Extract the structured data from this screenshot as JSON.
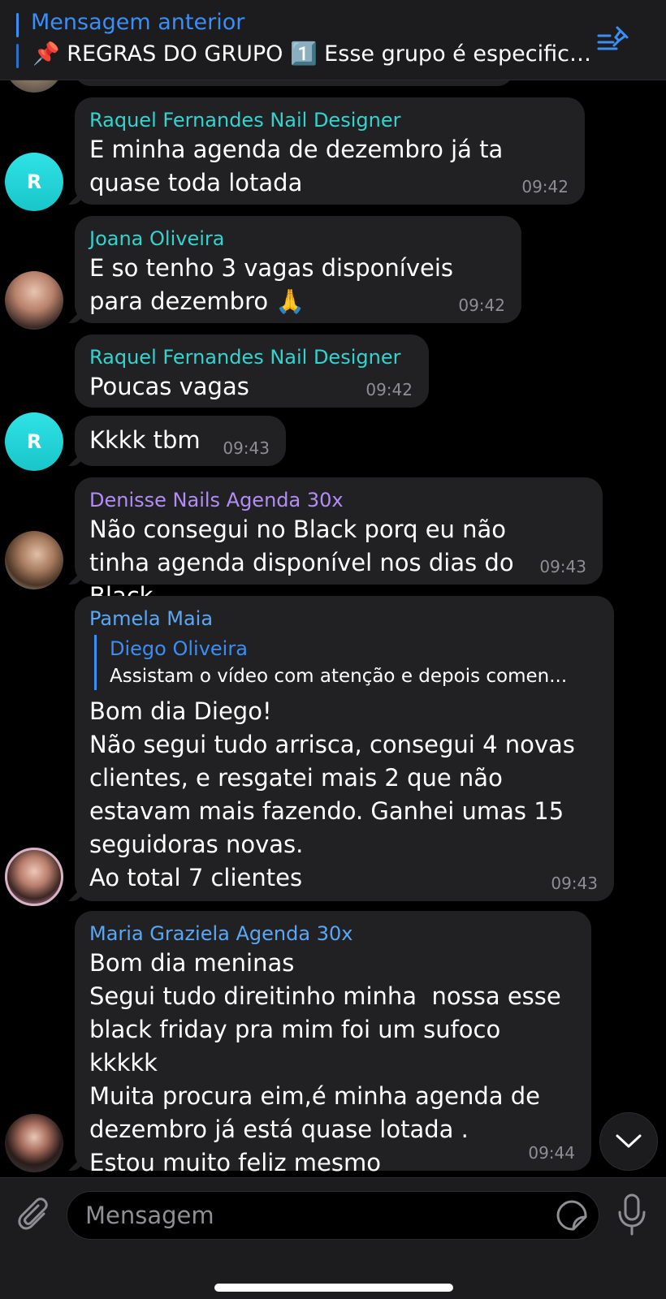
{
  "pinned": {
    "title": "Mensagem anterior",
    "text": "📌 REGRAS DO GRUPO 1️⃣ Esse grupo é especifica..."
  },
  "messages": [
    {
      "sender": "Raquel Fernandes Nail Designer",
      "sender_color": "#34d3cf",
      "text": "E minha agenda de dezembro já ta quase toda lotada",
      "time": "09:42"
    },
    {
      "sender": "Joana Oliveira",
      "sender_color": "#34d3cf",
      "text": "E so tenho 3 vagas disponíveis para dezembro 🙏",
      "time": "09:42"
    },
    {
      "sender": "Raquel Fernandes Nail Designer",
      "sender_color": "#34d3cf",
      "text": "Poucas vagas",
      "time": "09:42"
    },
    {
      "text": "Kkkk tbm",
      "time": "09:43",
      "avatar_letter": "R"
    },
    {
      "sender": "Denisse Nails Agenda 30x",
      "sender_color": "#b38df5",
      "text": "Não consegui no Black porq eu não tinha agenda disponível nos dias do Black",
      "time": "09:43"
    },
    {
      "sender": "Pamela Maia",
      "sender_color": "#5aa7f5",
      "reply_name": "Diego Oliveira",
      "reply_text": "Assistam o vídeo com atenção e depois comen...",
      "text": "Bom dia Diego!\nNão segui tudo arrisca, consegui 4 novas clientes, e resgatei mais 2 que não estavam mais fazendo. Ganhei umas 15 seguidoras novas.\nAo total 7 clientes",
      "time": "09:43"
    },
    {
      "sender": "Maria Graziela Agenda 30x",
      "sender_color": "#5aa7f5",
      "text": "Bom dia meninas\nSegui tudo direitinho minha  nossa esse black friday pra mim foi um sufoco kkkkk\nMuita procura eim,é minha agenda de dezembro já está quase lotada .\nEstou muito feliz mesmo",
      "time": "09:44"
    }
  ],
  "avatar_letter": "R",
  "composer": {
    "placeholder": "Mensagem"
  },
  "icons": {
    "pinned_list": "pinned-list-icon",
    "scroll_down": "chevron-down-icon",
    "attach": "paperclip-icon",
    "sticker": "sticker-icon",
    "mic": "microphone-icon"
  },
  "colors": {
    "accent": "#3a8ef6",
    "bubble": "#212123",
    "background": "#000000",
    "time": "#8e8e93"
  }
}
